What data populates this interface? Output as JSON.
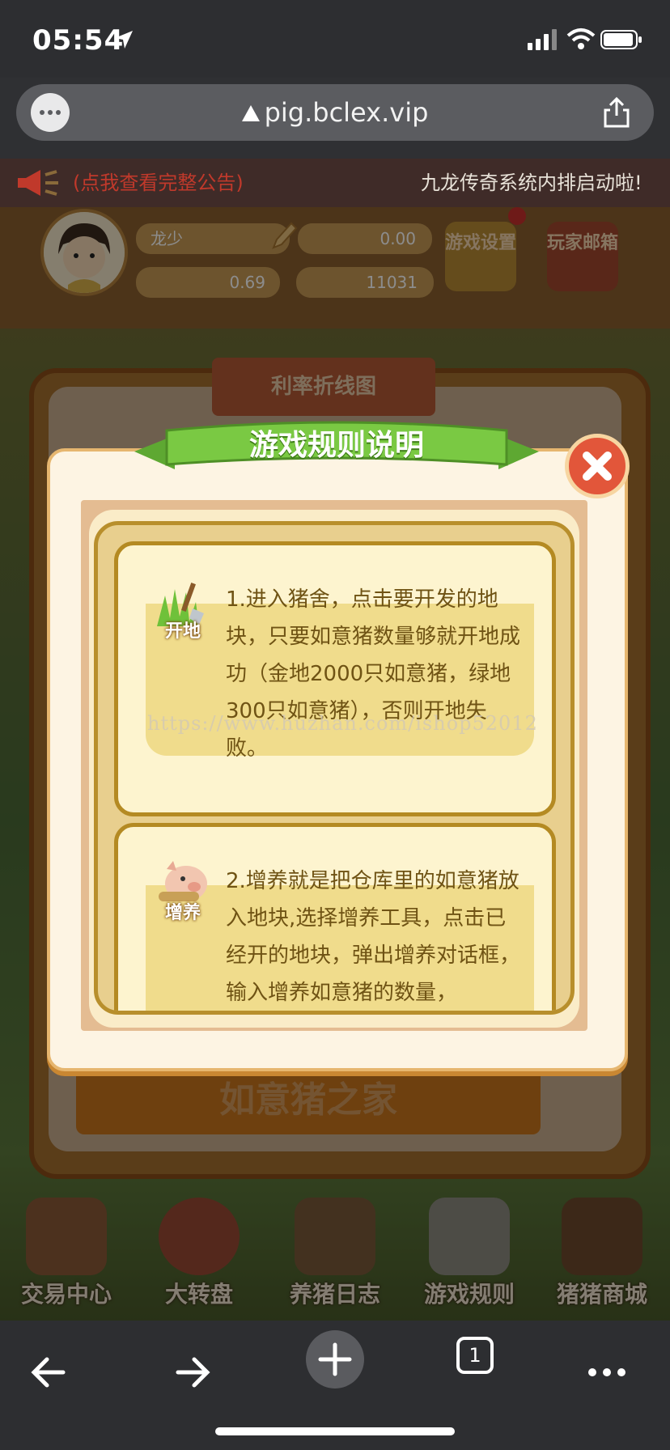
{
  "status_bar": {
    "time": "05:54"
  },
  "browser": {
    "url": "pig.bclex.vip"
  },
  "notice": {
    "left": "(点我查看完整公告)",
    "right": "九龙传奇系统内排启动啦!"
  },
  "hud": {
    "player_name": "龙少",
    "balance": "0.00",
    "rate": "0.69",
    "count": "11031",
    "btn_settings": "游戏设置",
    "btn_mail": "玩家邮箱"
  },
  "background": {
    "panel_title": "利率折线图",
    "home_button": "如意猪之家"
  },
  "bottom_nav": [
    {
      "label": "交易中心",
      "icon": "house-icon"
    },
    {
      "label": "大转盘",
      "icon": "wheel-icon"
    },
    {
      "label": "养猪日志",
      "icon": "book-icon"
    },
    {
      "label": "游戏规则",
      "icon": "clipboard-icon"
    },
    {
      "label": "猪猪商城",
      "icon": "bag-icon"
    }
  ],
  "modal": {
    "title": "游戏规则说明",
    "rules": [
      {
        "icon": "shovel-grass-icon",
        "tag": "开地",
        "text": "1.进入猪舍，点击要开发的地块，只要如意猪数量够就开地成功（金地2000只如意猪，绿地300只如意猪），否则开地失败。"
      },
      {
        "icon": "pig-icon",
        "tag": "增养",
        "text": "2.增养就是把仓库里的如意猪放入地块,选择增养工具，点击已经开的地块，弹出增养对话框，输入增养如意猪的数量，"
      }
    ]
  },
  "watermark": "https://www.huzhan.com/ishop52012",
  "toolbar": {
    "tab_count": "1"
  },
  "colors": {
    "ribbon": "#7ac943",
    "close": "#e2563a",
    "modal_border": "#e6b66f"
  }
}
